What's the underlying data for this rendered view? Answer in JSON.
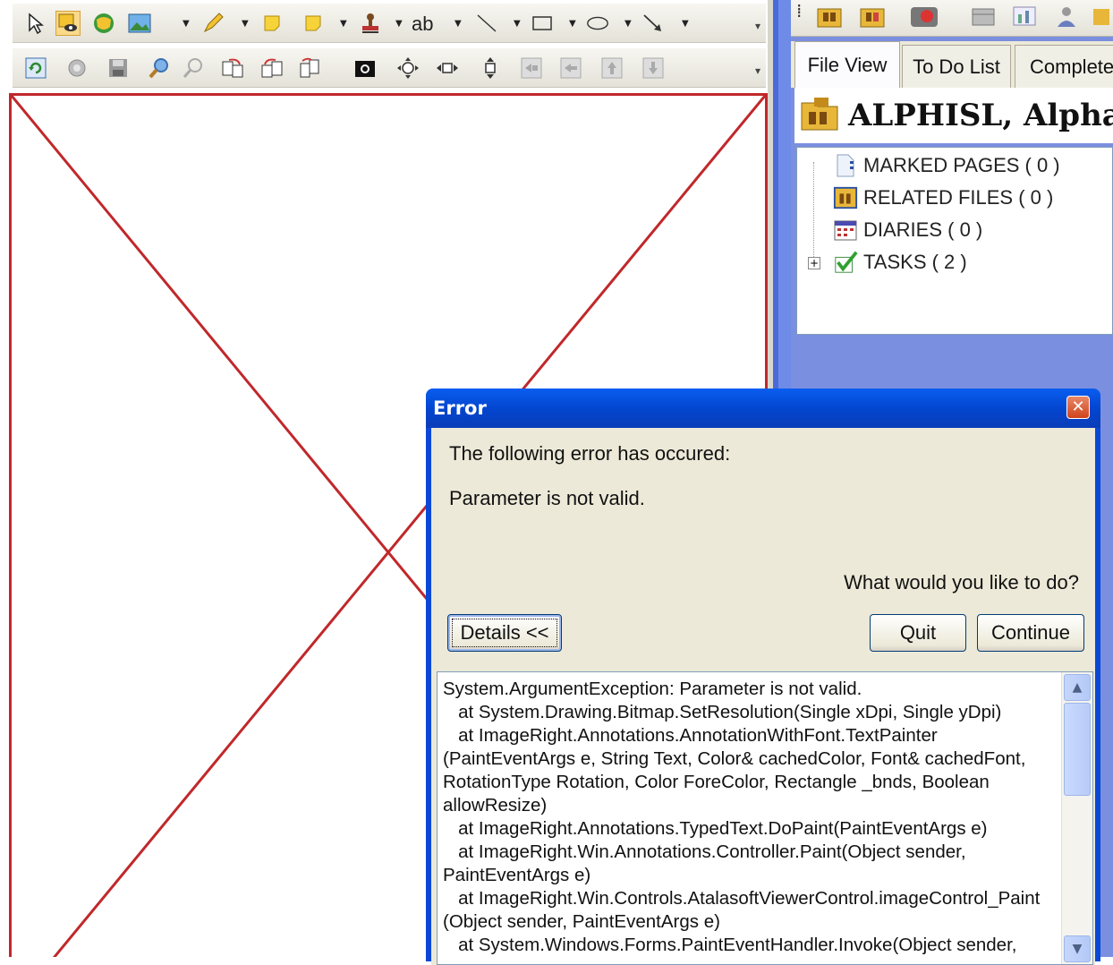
{
  "toolbar_top": {
    "text_tool_label": "ab",
    "items": [
      "pointer-icon",
      "highlight-view-icon",
      "globe-icon",
      "image-icon",
      "pen-icon",
      "sticky-note-icon",
      "sticky-note-icon",
      "stamp-icon",
      "text-icon",
      "line-icon",
      "rectangle-icon",
      "ellipse-icon",
      "arrow-icon"
    ]
  },
  "toolbar_bottom": {
    "items": [
      "refresh-icon",
      "settings-icon",
      "save-icon",
      "zoom-in-icon",
      "zoom-out-icon",
      "rotate-right-icon",
      "rotate-left-icon",
      "flip-icon",
      "camera-icon",
      "pan-icon",
      "move-horizontal-icon",
      "move-vertical-icon",
      "first-page-icon",
      "prev-page-icon",
      "next-page-icon",
      "last-page-icon"
    ]
  },
  "right_panel": {
    "tabs": [
      {
        "label": "File View",
        "selected": true
      },
      {
        "label": "To Do List",
        "selected": false
      },
      {
        "label": "Completed",
        "selected": false
      }
    ],
    "file_title": "ALPHISL, Alpha",
    "tree": [
      {
        "label": "MARKED PAGES ( 0 )",
        "icon": "marked-pages-icon"
      },
      {
        "label": "RELATED FILES ( 0 )",
        "icon": "related-files-icon"
      },
      {
        "label": "DIARIES ( 0 )",
        "icon": "diaries-icon"
      },
      {
        "label": "TASKS ( 2 )",
        "icon": "tasks-icon",
        "expandable": true
      }
    ]
  },
  "dialog": {
    "title": "Error",
    "message": "The following error has occured:",
    "error": "Parameter is not valid.",
    "question": "What would you like to do?",
    "details_button": "Details <<",
    "quit_button": "Quit",
    "continue_button": "Continue",
    "close_glyph": "✕",
    "details_text": "System.ArgumentException: Parameter is not valid.\n   at System.Drawing.Bitmap.SetResolution(Single xDpi, Single yDpi)\n   at ImageRight.Annotations.AnnotationWithFont.TextPainter\n(PaintEventArgs e, String Text, Color& cachedColor, Font& cachedFont,\nRotationType Rotation, Color ForeColor, Rectangle _bnds, Boolean\nallowResize)\n   at ImageRight.Annotations.TypedText.DoPaint(PaintEventArgs e)\n   at ImageRight.Win.Annotations.Controller.Paint(Object sender,\nPaintEventArgs e)\n   at ImageRight.Win.Controls.AtalasoftViewerControl.imageControl_Paint\n(Object sender, PaintEventArgs e)\n   at System.Windows.Forms.PaintEventHandler.Invoke(Object sender,"
  },
  "colors": {
    "canvas_border": "#c0282b",
    "dialog_titlebar": "#0346d0",
    "dialog_body": "#ece9d8",
    "panel_background": "#7b8fe0"
  }
}
